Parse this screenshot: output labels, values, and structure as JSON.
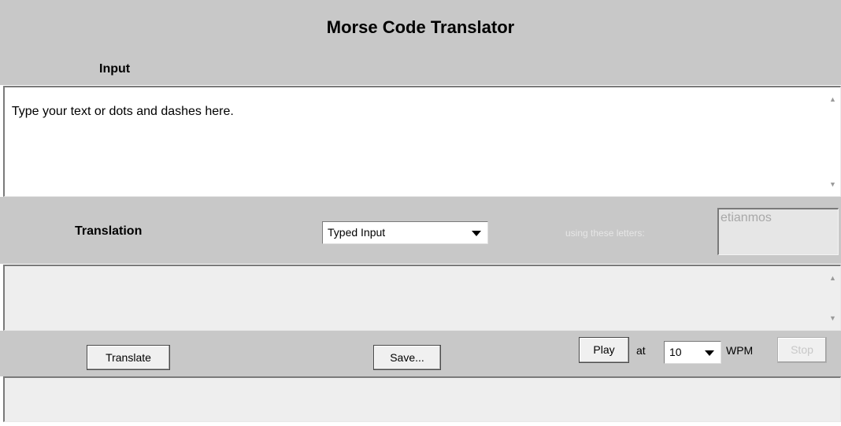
{
  "app": {
    "title": "Morse Code Translator"
  },
  "input": {
    "label": "Input",
    "text": "Type your text or dots and dashes here."
  },
  "translation": {
    "label": "Translation",
    "mode": {
      "selected": "Typed Input"
    },
    "letters_label": "using these letters:",
    "letters_value": "etianmos",
    "output": ""
  },
  "controls": {
    "translate_label": "Translate",
    "save_label": "Save...",
    "play_label": "Play",
    "at_label": "at",
    "wpm_value": "10",
    "wpm_label": "WPM",
    "stop_label": "Stop"
  },
  "status": {
    "text": ""
  },
  "icons": {
    "scroll_up": "chevron-up-icon",
    "scroll_down": "chevron-down-icon",
    "dropdown": "dropdown-arrow-icon"
  }
}
